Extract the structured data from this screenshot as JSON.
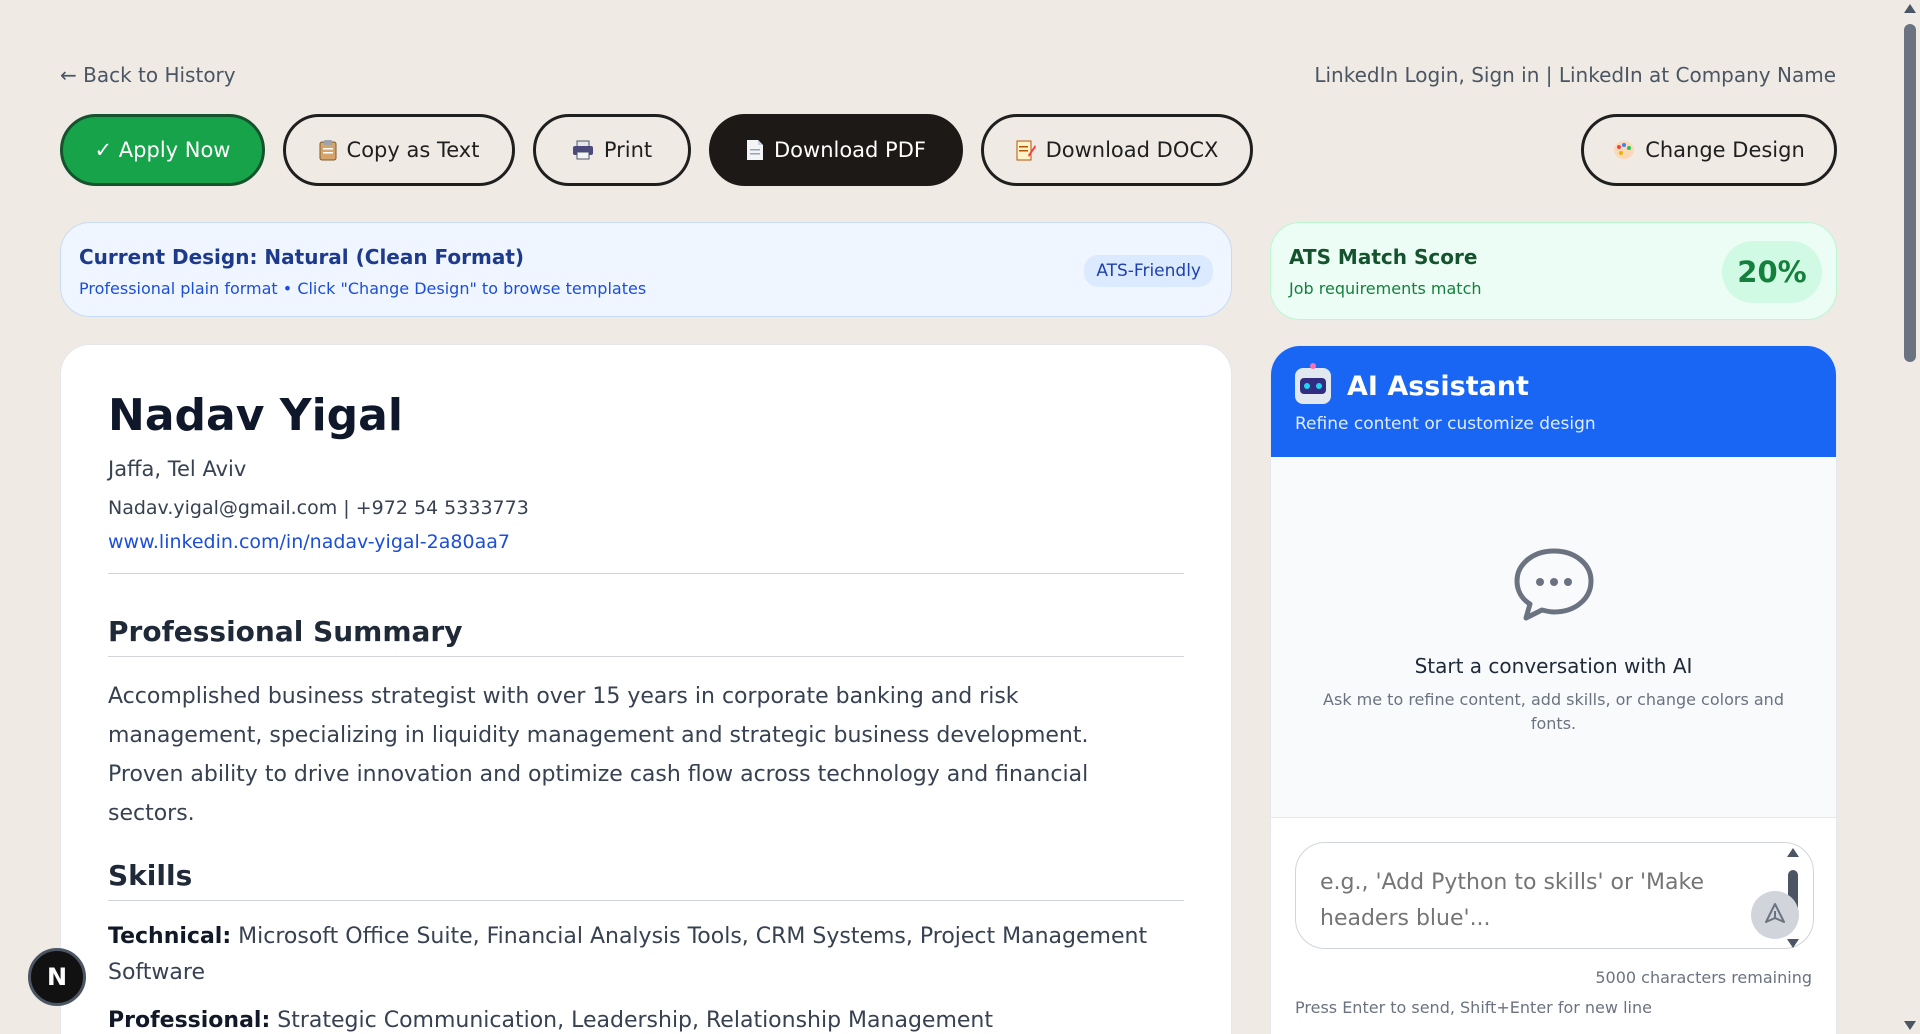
{
  "nav": {
    "back_label": "← Back to History",
    "job_title": "LinkedIn Login, Sign in | LinkedIn at Company Name"
  },
  "toolbar": {
    "apply_label": "✓ Apply Now",
    "copy_label": "Copy as Text",
    "print_label": "Print",
    "pdf_label": "Download PDF",
    "docx_label": "Download DOCX",
    "design_label": "Change Design"
  },
  "design_banner": {
    "title": "Current Design: Natural (Clean Format)",
    "subtitle": "Professional plain format • Click \"Change Design\" to browse templates",
    "badge": "ATS-Friendly"
  },
  "ats": {
    "title": "ATS Match Score",
    "subtitle": "Job requirements match",
    "score": "20%"
  },
  "resume": {
    "name": "Nadav Yigal",
    "location": "Jaffa, Tel Aviv",
    "contact": "Nadav.yigal@gmail.com | +972 54 5333773",
    "linkedin": "www.linkedin.com/in/nadav-yigal-2a80aa7",
    "summary_heading": "Professional Summary",
    "summary": "Accomplished business strategist with over 15 years in corporate banking and risk management, specializing in liquidity management and strategic business development. Proven ability to drive innovation and optimize cash flow across technology and financial sectors.",
    "skills_heading": "Skills",
    "skills": [
      {
        "label": "Technical:",
        "value": "Microsoft Office Suite, Financial Analysis Tools, CRM Systems, Project Management Software"
      },
      {
        "label": "Professional:",
        "value": "Strategic Communication, Leadership, Relationship Management"
      }
    ]
  },
  "ai": {
    "title": "AI Assistant",
    "subtitle": "Refine content or customize design",
    "empty_heading": "Start a conversation with AI",
    "empty_desc": "Ask me to refine content, add skills, or change colors and fonts.",
    "input_placeholder": "e.g., 'Add Python to skills' or 'Make headers blue'...",
    "char_count": "5000 characters remaining",
    "hint": "Press Enter to send, Shift+Enter for new line"
  },
  "badge": {
    "letter": "N"
  },
  "colors": {
    "background": "#efebe4",
    "apply_green": "#16a34a",
    "pdf_dark": "#1c1917",
    "ai_blue": "#1966f5",
    "ats_green": "#15803d",
    "link_blue": "#1d4ed8"
  },
  "icons": {
    "copy": "clipboard-icon",
    "print": "printer-icon",
    "pdf": "document-icon",
    "docx": "memo-icon",
    "design": "palette-icon",
    "ai": "robot-icon",
    "empty": "chat-bubble-icon",
    "send": "send-icon"
  }
}
